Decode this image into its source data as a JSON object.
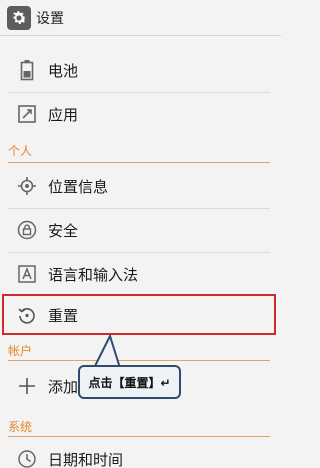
{
  "header": {
    "title": "设置",
    "icon": "gear-icon"
  },
  "items": {
    "battery": {
      "label": "电池",
      "icon": "battery-icon"
    },
    "apps": {
      "label": "应用",
      "icon": "apps-icon"
    },
    "location": {
      "label": "位置信息",
      "icon": "location-icon"
    },
    "security": {
      "label": "安全",
      "icon": "lock-icon"
    },
    "language": {
      "label": "语言和输入法",
      "icon": "language-icon"
    },
    "reset": {
      "label": "重置",
      "icon": "reset-icon"
    },
    "add_account": {
      "label": "添加",
      "icon": "plus-icon"
    },
    "datetime": {
      "label": "日期和时间",
      "icon": "clock-icon"
    }
  },
  "sections": {
    "personal": "个人",
    "accounts": "帐户",
    "system": "系统"
  },
  "annotation": {
    "callout_text": "点击【重置】↵"
  },
  "colors": {
    "section_text": "#e8852a",
    "highlight_border": "#d22a2a",
    "callout_border": "#2f4b6d"
  }
}
